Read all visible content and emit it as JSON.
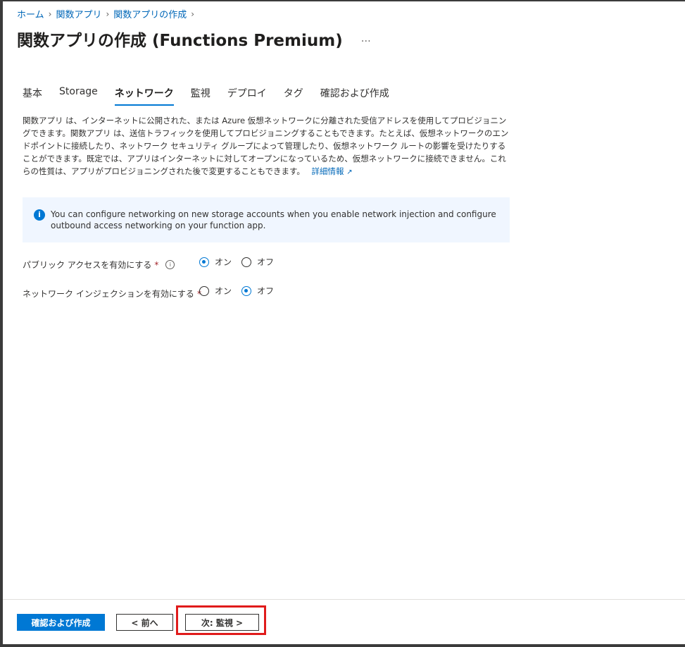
{
  "breadcrumb": [
    "ホーム",
    "関数アプリ",
    "関数アプリの作成"
  ],
  "title": "関数アプリの作成 (Functions Premium)",
  "more": "…",
  "tabs": [
    {
      "label": "基本",
      "active": false
    },
    {
      "label": "Storage",
      "active": false
    },
    {
      "label": "ネットワーク",
      "active": true
    },
    {
      "label": "監視",
      "active": false
    },
    {
      "label": "デプロイ",
      "active": false
    },
    {
      "label": "タグ",
      "active": false
    },
    {
      "label": "確認および作成",
      "active": false
    }
  ],
  "description": {
    "text": "関数アプリ は、インターネットに公開された、または Azure 仮想ネットワークに分離された受信アドレスを使用してプロビジョニングできます。関数アプリ は、送信トラフィックを使用してプロビジョニングすることもできます。たとえば、仮想ネットワークのエンドポイントに接続したり、ネットワーク セキュリティ グループによって管理したり、仮想ネットワーク ルートの影響を受けたりすることができます。既定では、アプリはインターネットに対してオープンになっているため、仮想ネットワークに接続できません。これらの性質は、アプリがプロビジョニングされた後で変更することもできます。",
    "link": "詳細情報"
  },
  "info": {
    "icon": "info-icon",
    "text": "You can configure networking on new storage accounts when you enable network injection and configure outbound access networking on your function app."
  },
  "fields": {
    "public_access": {
      "label": "パブリック アクセスを有効にする",
      "required": "*",
      "options": [
        "オン",
        "オフ"
      ],
      "selected": "オン"
    },
    "network_injection": {
      "label": "ネットワーク インジェクションを有効にする",
      "required": "*",
      "options": [
        "オン",
        "オフ"
      ],
      "selected": "オフ"
    }
  },
  "footer": {
    "review_create": "確認および作成",
    "prev": "< 前へ",
    "next": "次: 監視 >"
  },
  "colors": {
    "accent": "#0078d4",
    "highlight": "#e01b1b",
    "info_bg": "#f0f6ff"
  }
}
